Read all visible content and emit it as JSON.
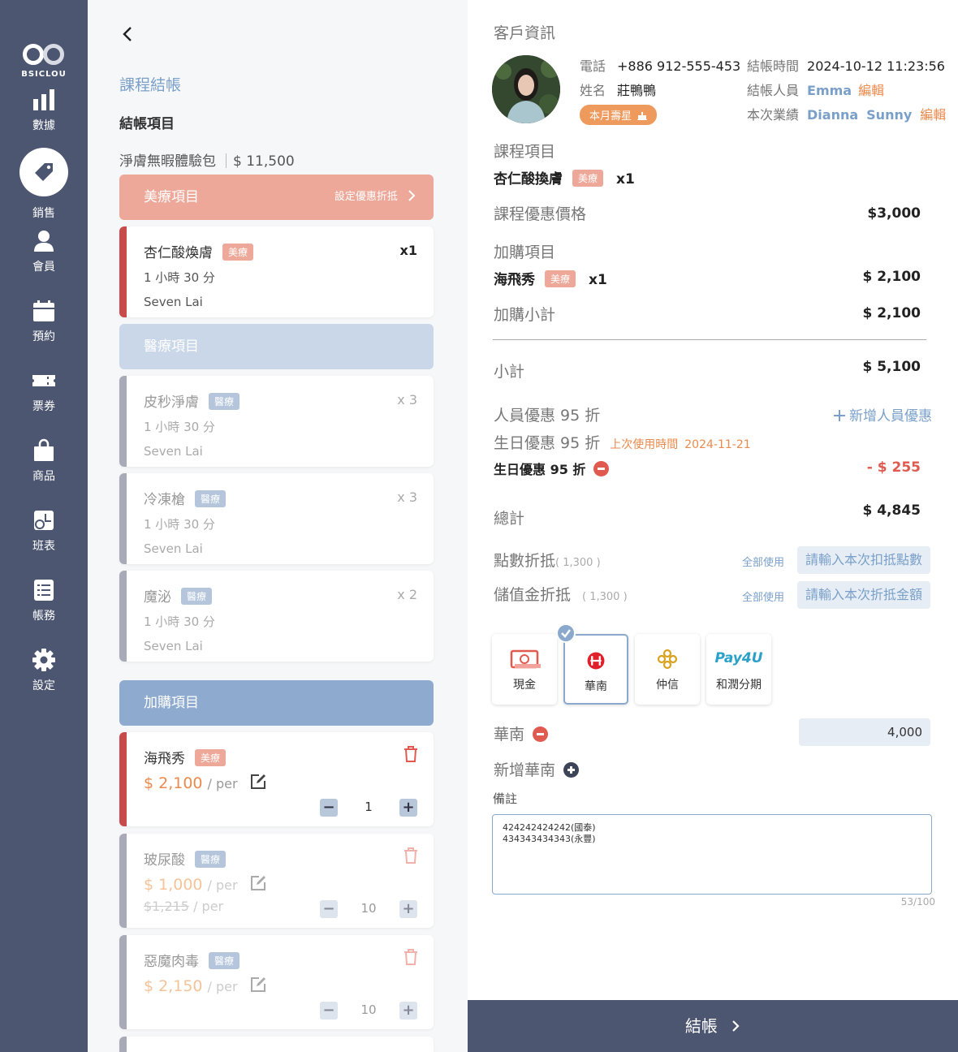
{
  "sidebar": {
    "logo_text": "BSICLOU",
    "items": [
      {
        "label": "數據",
        "icon": "bar-chart-icon"
      },
      {
        "label": "銷售",
        "icon": "price-tag-icon",
        "active": true
      },
      {
        "label": "會員",
        "icon": "person-icon"
      },
      {
        "label": "預約",
        "icon": "calendar-icon"
      },
      {
        "label": "票券",
        "icon": "ticket-icon"
      },
      {
        "label": "商品",
        "icon": "shopping-bag-icon"
      },
      {
        "label": "班表",
        "icon": "schedule-icon"
      },
      {
        "label": "帳務",
        "icon": "ledger-icon"
      },
      {
        "label": "設定",
        "icon": "gear-icon"
      }
    ]
  },
  "left": {
    "page_title": "課程結帳",
    "section_title": "結帳項目",
    "package": {
      "name": "淨膚無暇體驗包",
      "price": "$ 11,500"
    },
    "beauty_section": {
      "label": "美療項目",
      "action": "設定優惠折抵"
    },
    "beauty_items": [
      {
        "name": "杏仁酸煥膚",
        "tag": "美療",
        "qty": "x1",
        "duration": "1 小時 30 分",
        "staff": "Seven Lai"
      }
    ],
    "medical_section": {
      "label": "醫療項目"
    },
    "medical_items": [
      {
        "name": "皮秒淨膚",
        "tag": "醫療",
        "qty": "x 3",
        "duration": "1 小時 30 分",
        "staff": "Seven Lai"
      },
      {
        "name": "冷凍槍",
        "tag": "醫療",
        "qty": "x 3",
        "duration": "1 小時 30 分",
        "staff": "Seven Lai"
      },
      {
        "name": "魔泌",
        "tag": "醫療",
        "qty": "x 2",
        "duration": "1 小時 30 分",
        "staff": "Seven Lai"
      }
    ],
    "addon_section": {
      "label": "加購項目"
    },
    "addon_items": [
      {
        "name": "海飛秀",
        "tag": "美療",
        "price": "$ 2,100",
        "per": "/ per",
        "qty": "1"
      },
      {
        "name": "玻尿酸",
        "tag": "醫療",
        "price": "$ 1,000",
        "per": "/ per",
        "old_price": "$1,215",
        "old_per": "/ per",
        "qty": "10"
      },
      {
        "name": "惡魔肉毒",
        "tag": "醫療",
        "price": "$ 2,150",
        "per": "/ per",
        "qty": "10"
      }
    ]
  },
  "right": {
    "customer_title": "客戶資訊",
    "phone_label": "電話",
    "phone": "+886 912-555-453",
    "name_label": "姓名",
    "name": "莊鴨鴨",
    "birthday_badge": "本月壽星",
    "time_label": "結帳時間",
    "time": "2024-10-12  11:23:56",
    "cashier_label": "結帳人員",
    "cashier": "Emma",
    "edit": "編輯",
    "perf_label": "本次業績",
    "perf_1": "Dianna",
    "perf_2": "Sunny",
    "course_title": "課程項目",
    "course_item": {
      "name": "杏仁酸換膚",
      "tag": "美療",
      "qty": "x1"
    },
    "course_price_label": "課程優惠價格",
    "course_price": "$3,000",
    "addon_title": "加購項目",
    "addon_item": {
      "name": "海飛秀",
      "tag": "美療",
      "qty": "x1",
      "price": "$ 2,100"
    },
    "addon_subtotal_label": "加購小計",
    "addon_subtotal": "$ 2,100",
    "subtotal_label": "小計",
    "subtotal": "$ 5,100",
    "staff_discount": "人員優惠 95 折",
    "add_staff_discount": "新增人員優惠",
    "bday_discount": "生日優惠 95 折",
    "last_used_label": "上次使用時間",
    "last_used": "2024-11-21",
    "bday_discount_applied": "生日優惠 95 折",
    "bday_discount_amount": "- $ 255",
    "total_label": "總計",
    "total": "$ 4,845",
    "points_label": "點數折抵",
    "points_avail": "( 1,300 )",
    "use_all": "全部使用",
    "points_placeholder": "請輸入本次扣抵點數",
    "stored_label": "儲值金折抵",
    "stored_avail": "( 1,300 )",
    "stored_placeholder": "請輸入本次折抵金額",
    "payments": [
      {
        "label": "現金",
        "icon": "cash-icon"
      },
      {
        "label": "華南",
        "icon": "huanan-bank-icon",
        "selected": true
      },
      {
        "label": "仲信",
        "icon": "chailease-icon"
      },
      {
        "label": "和潤分期",
        "icon": "pay4u-logo-icon",
        "logo_text": "Pay4U"
      }
    ],
    "method_label": "華南",
    "method_amount": "4,000",
    "add_method": "新增華南",
    "memo_label": "備註",
    "memo": "424242424242(國泰)\n434343434343(永豐)",
    "memo_count": "53/100",
    "checkout": "結帳"
  },
  "colors": {
    "sidebar": "#4c5670",
    "beauty_header": "#eea899",
    "medical_header": "#c9d7e8",
    "addon_header": "#8eabcf",
    "accent_orange": "#ea8a4c",
    "accent_red": "#e05a4f"
  }
}
